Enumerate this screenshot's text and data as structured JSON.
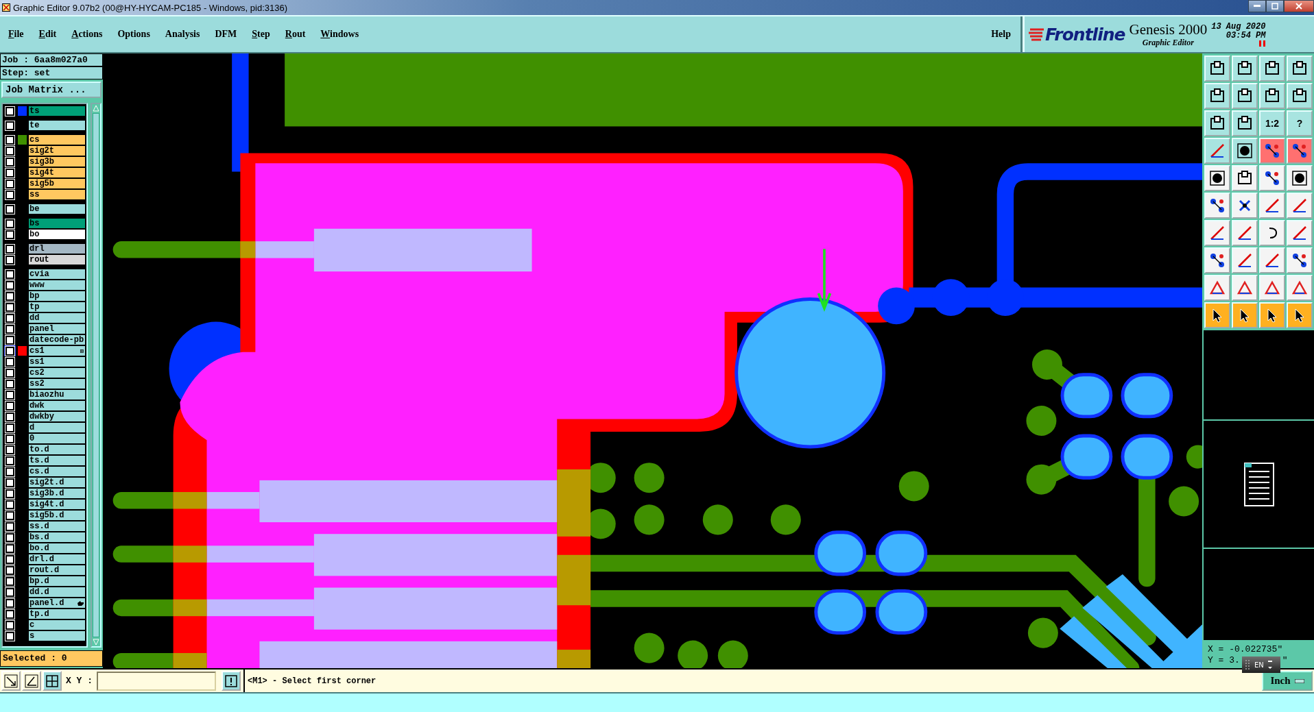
{
  "window": {
    "title": "Graphic Editor 9.07b2 (00@HY-HYCAM-PC185 - Windows, pid:3136)"
  },
  "menu": [
    {
      "label": "File",
      "mnemonic": true
    },
    {
      "label": "Edit",
      "mnemonic": true
    },
    {
      "label": "Actions",
      "mnemonic": true
    },
    {
      "label": "Options",
      "mnemonic": false
    },
    {
      "label": "Analysis",
      "mnemonic": false
    },
    {
      "label": "DFM",
      "mnemonic": false
    },
    {
      "label": "Step",
      "mnemonic": true
    },
    {
      "label": "Rout",
      "mnemonic": true
    },
    {
      "label": "Windows",
      "mnemonic": true
    }
  ],
  "help": "Help",
  "brand": {
    "logo": "Frontline",
    "product": "Genesis 2000",
    "subtitle": "Graphic Editor",
    "date": "13 Aug 2020",
    "time": "03:54 PM"
  },
  "job": {
    "job": "Job : 6aa8m027a0",
    "step": "Step: set",
    "matrix_button": "Job Matrix ..."
  },
  "layer_groups": [
    {
      "layers": [
        {
          "name": "ts",
          "kind": "mask",
          "color": "#0030ff",
          "checked": false,
          "work": false,
          "pointer": false
        }
      ]
    },
    {
      "layers": [
        {
          "name": "te",
          "kind": "document",
          "checked": false,
          "work": false,
          "pointer": false
        }
      ]
    },
    {
      "layers": [
        {
          "name": "cs",
          "kind": "signal",
          "color": "#409000",
          "checked": false,
          "work": false,
          "pointer": false
        },
        {
          "name": "sig2t",
          "kind": "signal",
          "checked": false,
          "work": false,
          "pointer": false
        },
        {
          "name": "sig3b",
          "kind": "signal",
          "checked": false,
          "work": false,
          "pointer": false
        },
        {
          "name": "sig4t",
          "kind": "signal",
          "checked": false,
          "work": false,
          "pointer": false
        },
        {
          "name": "sig5b",
          "kind": "signal",
          "checked": false,
          "work": false,
          "pointer": false
        },
        {
          "name": "ss",
          "kind": "signal",
          "checked": false,
          "work": false,
          "pointer": false
        }
      ]
    },
    {
      "layers": [
        {
          "name": "be",
          "kind": "document",
          "checked": false,
          "work": false,
          "pointer": false
        }
      ]
    },
    {
      "layers": [
        {
          "name": "bs",
          "kind": "mask",
          "checked": false,
          "work": false,
          "pointer": false
        },
        {
          "name": "bo",
          "kind": "silk",
          "checked": false,
          "work": false,
          "pointer": false
        }
      ]
    },
    {
      "layers": [
        {
          "name": "drl",
          "kind": "drill",
          "checked": false,
          "work": false,
          "pointer": false
        },
        {
          "name": "rout",
          "kind": "rout",
          "checked": false,
          "work": false,
          "pointer": false
        }
      ]
    },
    {
      "layers": [
        {
          "name": "cvia",
          "kind": "document",
          "checked": false,
          "work": false,
          "pointer": false
        },
        {
          "name": "www",
          "kind": "document",
          "checked": false,
          "work": false,
          "pointer": false
        },
        {
          "name": "bp",
          "kind": "document",
          "checked": false,
          "work": false,
          "pointer": false
        },
        {
          "name": "tp",
          "kind": "document",
          "checked": false,
          "work": false,
          "pointer": false
        },
        {
          "name": "dd",
          "kind": "document",
          "checked": false,
          "work": false,
          "pointer": false
        },
        {
          "name": "panel",
          "kind": "document",
          "checked": false,
          "work": false,
          "pointer": false
        },
        {
          "name": "datecode-pb",
          "kind": "document",
          "checked": false,
          "work": false,
          "pointer": false
        },
        {
          "name": "cs1",
          "kind": "document",
          "color": "#ff0000",
          "checked": false,
          "work": true,
          "badge": "⊞",
          "pointer": false
        },
        {
          "name": "ss1",
          "kind": "document",
          "checked": false,
          "work": false,
          "pointer": false
        },
        {
          "name": "cs2",
          "kind": "document",
          "checked": false,
          "work": false,
          "pointer": false
        },
        {
          "name": "ss2",
          "kind": "document",
          "checked": false,
          "work": false,
          "pointer": false
        },
        {
          "name": "biaozhu",
          "kind": "document",
          "checked": false,
          "work": false,
          "pointer": false
        },
        {
          "name": "dwk",
          "kind": "document",
          "checked": false,
          "work": false,
          "pointer": false
        },
        {
          "name": "dwkby",
          "kind": "document",
          "checked": false,
          "work": false,
          "pointer": false
        },
        {
          "name": "d",
          "kind": "document",
          "checked": false,
          "work": false,
          "pointer": false
        },
        {
          "name": "0",
          "kind": "document",
          "checked": false,
          "work": false,
          "pointer": false
        },
        {
          "name": "to.d",
          "kind": "document",
          "checked": false,
          "work": false,
          "pointer": false
        },
        {
          "name": "ts.d",
          "kind": "document",
          "checked": false,
          "work": false,
          "pointer": false
        },
        {
          "name": "cs.d",
          "kind": "document",
          "checked": false,
          "work": false,
          "pointer": false
        },
        {
          "name": "sig2t.d",
          "kind": "document",
          "checked": false,
          "work": false,
          "pointer": false
        },
        {
          "name": "sig3b.d",
          "kind": "document",
          "checked": false,
          "work": false,
          "pointer": false
        },
        {
          "name": "sig4t.d",
          "kind": "document",
          "checked": false,
          "work": false,
          "pointer": false
        },
        {
          "name": "sig5b.d",
          "kind": "document",
          "checked": false,
          "work": false,
          "pointer": false
        },
        {
          "name": "ss.d",
          "kind": "document",
          "checked": false,
          "work": false,
          "pointer": false
        },
        {
          "name": "bs.d",
          "kind": "document",
          "checked": false,
          "work": false,
          "pointer": false
        },
        {
          "name": "bo.d",
          "kind": "document",
          "checked": false,
          "work": false,
          "pointer": false
        },
        {
          "name": "drl.d",
          "kind": "document",
          "checked": false,
          "work": false,
          "pointer": false
        },
        {
          "name": "rout.d",
          "kind": "document",
          "checked": false,
          "work": false,
          "pointer": false
        },
        {
          "name": "bp.d",
          "kind": "document",
          "checked": false,
          "work": false,
          "pointer": false
        },
        {
          "name": "dd.d",
          "kind": "document",
          "checked": false,
          "work": false,
          "pointer": false
        },
        {
          "name": "panel.d",
          "kind": "document",
          "checked": false,
          "work": false,
          "pointer": true
        },
        {
          "name": "tp.d",
          "kind": "document",
          "checked": false,
          "work": false,
          "pointer": false
        },
        {
          "name": "c",
          "kind": "document",
          "checked": false,
          "work": false,
          "pointer": false
        },
        {
          "name": "s",
          "kind": "document",
          "checked": false,
          "work": false,
          "pointer": false
        }
      ]
    }
  ],
  "selected_count": "Selected : 0",
  "toolbar": [
    {
      "kind": "icon"
    },
    {
      "kind": "icon"
    },
    {
      "kind": "icon"
    },
    {
      "kind": "icon"
    },
    {
      "kind": "icon"
    },
    {
      "kind": "icon"
    },
    {
      "kind": "icon"
    },
    {
      "kind": "icon"
    },
    {
      "kind": "icon"
    },
    {
      "kind": "icon"
    },
    {
      "kind": "text",
      "label": "1:2"
    },
    {
      "kind": "text",
      "label": "?"
    },
    {
      "kind": "icon"
    },
    {
      "kind": "icon"
    },
    {
      "kind": "icon"
    },
    {
      "kind": "icon"
    },
    {
      "kind": "icon"
    },
    {
      "kind": "icon"
    },
    {
      "kind": "icon"
    },
    {
      "kind": "icon"
    },
    {
      "kind": "icon"
    },
    {
      "kind": "icon"
    },
    {
      "kind": "icon"
    },
    {
      "kind": "icon"
    },
    {
      "kind": "icon"
    },
    {
      "kind": "icon"
    },
    {
      "kind": "icon"
    },
    {
      "kind": "icon"
    },
    {
      "kind": "icon"
    },
    {
      "kind": "icon"
    },
    {
      "kind": "icon"
    },
    {
      "kind": "icon"
    },
    {
      "kind": "icon"
    },
    {
      "kind": "icon"
    },
    {
      "kind": "icon"
    },
    {
      "kind": "icon"
    },
    {
      "kind": "icon"
    },
    {
      "kind": "icon"
    },
    {
      "kind": "icon"
    },
    {
      "kind": "icon"
    }
  ],
  "coordinates": {
    "x": "X = -0.022735\"",
    "y_start": "Y = 3.",
    "y_end": "\""
  },
  "ime": {
    "label": "EN"
  },
  "command": {
    "xy_label": "X Y :",
    "prompt": "<M1> - Select first corner",
    "units": "Inch"
  }
}
